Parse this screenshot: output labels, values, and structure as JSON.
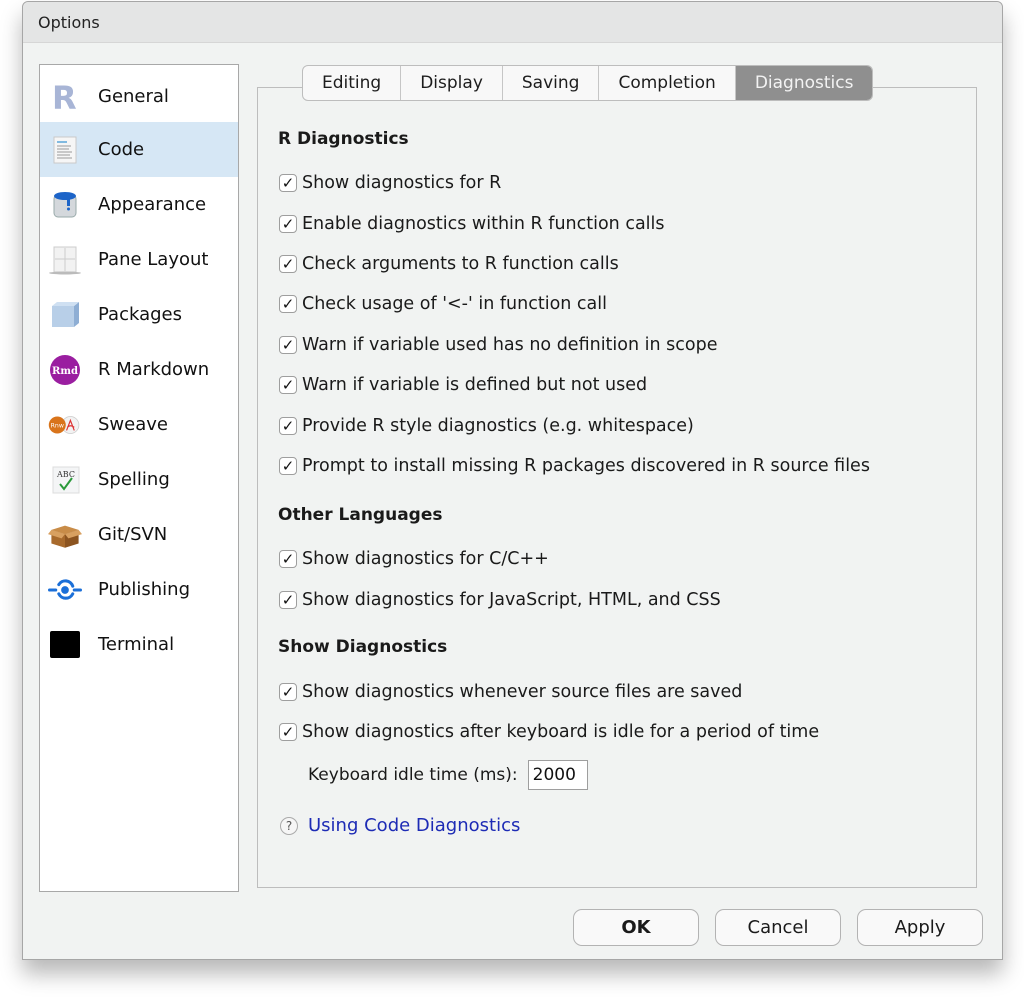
{
  "window": {
    "title": "Options"
  },
  "sidebar": {
    "items": [
      {
        "label": "General",
        "icon": "r-logo-icon",
        "active": false
      },
      {
        "label": "Code",
        "icon": "code-document-icon",
        "active": true
      },
      {
        "label": "Appearance",
        "icon": "paint-bucket-icon",
        "active": false
      },
      {
        "label": "Pane Layout",
        "icon": "pane-layout-icon",
        "active": false
      },
      {
        "label": "Packages",
        "icon": "package-box-icon",
        "active": false
      },
      {
        "label": "R Markdown",
        "icon": "rmd-icon",
        "active": false
      },
      {
        "label": "Sweave",
        "icon": "sweave-pdf-icon",
        "active": false
      },
      {
        "label": "Spelling",
        "icon": "abc-check-icon",
        "active": false
      },
      {
        "label": "Git/SVN",
        "icon": "cardboard-box-icon",
        "active": false
      },
      {
        "label": "Publishing",
        "icon": "publishing-icon",
        "active": false
      },
      {
        "label": "Terminal",
        "icon": "terminal-icon",
        "active": false
      }
    ]
  },
  "tabs": [
    {
      "label": "Editing",
      "active": false
    },
    {
      "label": "Display",
      "active": false
    },
    {
      "label": "Saving",
      "active": false
    },
    {
      "label": "Completion",
      "active": false
    },
    {
      "label": "Diagnostics",
      "active": true
    }
  ],
  "sections": {
    "r_diagnostics": {
      "title": "R Diagnostics",
      "options": [
        {
          "label": "Show diagnostics for R",
          "checked": true
        },
        {
          "label": "Enable diagnostics within R function calls",
          "checked": true
        },
        {
          "label": "Check arguments to R function calls",
          "checked": true
        },
        {
          "label": "Check usage of '<-' in function call",
          "checked": true
        },
        {
          "label": "Warn if variable used has no definition in scope",
          "checked": true
        },
        {
          "label": "Warn if variable is defined but not used",
          "checked": true
        },
        {
          "label": "Provide R style diagnostics (e.g. whitespace)",
          "checked": true
        },
        {
          "label": "Prompt to install missing R packages discovered in R source files",
          "checked": true
        }
      ]
    },
    "other_languages": {
      "title": "Other Languages",
      "options": [
        {
          "label": "Show diagnostics for C/C++",
          "checked": true
        },
        {
          "label": "Show diagnostics for JavaScript, HTML, and CSS",
          "checked": true
        }
      ]
    },
    "show_diagnostics": {
      "title": "Show Diagnostics",
      "options": [
        {
          "label": "Show diagnostics whenever source files are saved",
          "checked": true
        },
        {
          "label": "Show diagnostics after keyboard is idle for a period of time",
          "checked": true
        }
      ],
      "idle_label": "Keyboard idle time (ms):",
      "idle_value": "2000"
    }
  },
  "help": {
    "icon": "question-icon",
    "glyph": "?",
    "link": "Using Code Diagnostics"
  },
  "buttons": {
    "ok": "OK",
    "cancel": "Cancel",
    "apply": "Apply"
  },
  "check_glyph": "✓"
}
